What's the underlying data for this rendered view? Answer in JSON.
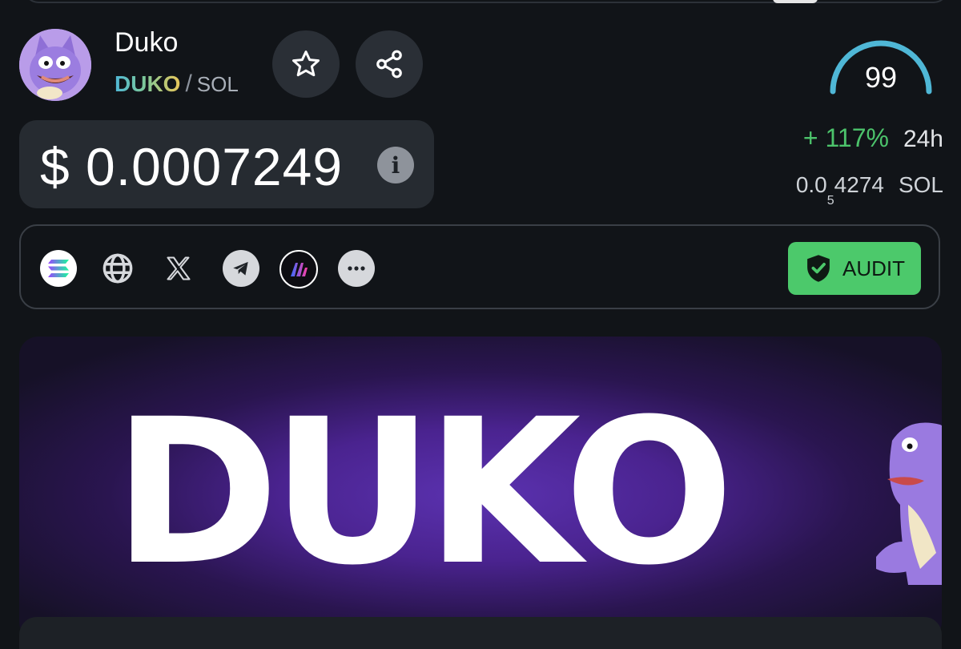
{
  "token": {
    "name": "Duko",
    "ticker": "DUKO",
    "pair_separator": "/",
    "quote": "SOL"
  },
  "score": {
    "value": "99",
    "fraction": 0.99
  },
  "price": {
    "usd": "$ 0.0007249",
    "info_icon_text": "i",
    "change": "+ 117%",
    "change_period": "24h",
    "sol_prefix": "0.0",
    "sol_zero_count": "5",
    "sol_digits": "4274",
    "sol_unit": "SOL"
  },
  "links": {
    "icons": [
      "solana-icon",
      "globe-icon",
      "x-icon",
      "telegram-icon",
      "dexscreener-icon",
      "more-icon"
    ],
    "audit_label": "AUDIT"
  },
  "banner": {
    "logo_text": "DUKO"
  },
  "colors": {
    "background": "#111418",
    "card": "#262b31",
    "positive": "#4cc36b",
    "audit": "#4cc96b",
    "gauge": "#4fb7d6",
    "banner_purple": "#5b32b0"
  }
}
